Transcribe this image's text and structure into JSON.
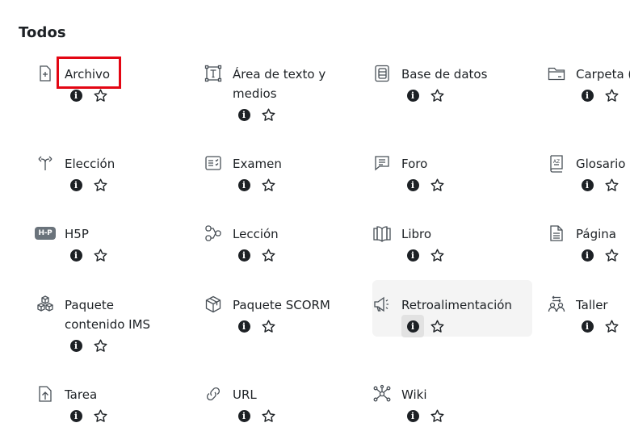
{
  "section": {
    "title": "Todos"
  },
  "items": [
    {
      "label": "Archivo",
      "icon": "file-plus-icon",
      "info": "i"
    },
    {
      "label": "Área de texto y\nmedios",
      "icon": "text-area-icon",
      "info": "i"
    },
    {
      "label": "Base de datos",
      "icon": "database-icon",
      "info": "i"
    },
    {
      "label": "Carpeta (",
      "icon": "folder-icon",
      "info": "i"
    },
    {
      "label": "Elección",
      "icon": "choice-icon",
      "info": "i"
    },
    {
      "label": "Examen",
      "icon": "quiz-icon",
      "info": "i"
    },
    {
      "label": "Foro",
      "icon": "forum-icon",
      "info": "i"
    },
    {
      "label": "Glosario",
      "icon": "glossary-icon",
      "info": "i"
    },
    {
      "label": "H5P",
      "icon": "h5p-icon",
      "icon_text": "H-P",
      "info": "i"
    },
    {
      "label": "Lección",
      "icon": "lesson-icon",
      "info": "i"
    },
    {
      "label": "Libro",
      "icon": "book-icon",
      "info": "i"
    },
    {
      "label": "Página",
      "icon": "page-icon",
      "info": "i"
    },
    {
      "label": "Paquete\ncontenido IMS",
      "icon": "ims-package-icon",
      "info": "i"
    },
    {
      "label": "Paquete SCORM",
      "icon": "scorm-package-icon",
      "info": "i"
    },
    {
      "label": "Retroalimentación",
      "icon": "feedback-icon",
      "info": "i"
    },
    {
      "label": "Taller",
      "icon": "workshop-icon",
      "info": "i"
    },
    {
      "label": "Tarea",
      "icon": "assignment-icon",
      "info": "i"
    },
    {
      "label": "URL",
      "icon": "url-icon",
      "info": "i"
    },
    {
      "label": "Wiki",
      "icon": "wiki-icon",
      "info": "i"
    }
  ],
  "highlight_color": "#e30613"
}
